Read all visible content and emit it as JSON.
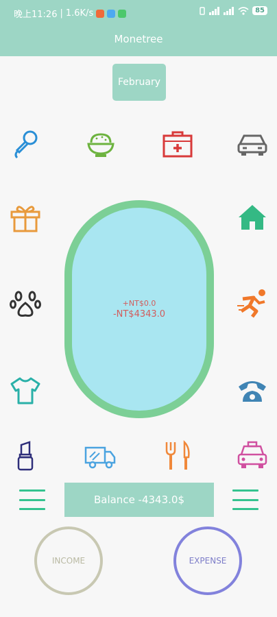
{
  "status_bar": {
    "time": "晚上11:26",
    "network_speed": "1.6K/s",
    "battery": "85",
    "colors": {
      "notif1": "#f06a3a",
      "notif2": "#4da9f1",
      "notif3": "#4cc86c"
    }
  },
  "app": {
    "title": "Monetree"
  },
  "month_selector": {
    "label": "February"
  },
  "summary": {
    "income_text": "+NT$0.0",
    "expense_text": "-NT$4343.0"
  },
  "balance": {
    "label": "Balance -4343.0$"
  },
  "actions": {
    "income_label": "INCOME",
    "expense_label": "EXPENSE"
  },
  "categories": [
    {
      "icon": "microphone-icon",
      "color": "#2a8fd6"
    },
    {
      "icon": "rice-bowl-icon",
      "color": "#6db33f"
    },
    {
      "icon": "first-aid-kit-icon",
      "color": "#d83a3a"
    },
    {
      "icon": "car-icon",
      "color": "#666666"
    },
    {
      "icon": "gift-icon",
      "color": "#e89a3c"
    },
    {
      "icon": "house-icon",
      "color": "#34b984"
    },
    {
      "icon": "paw-icon",
      "color": "#333333"
    },
    {
      "icon": "running-icon",
      "color": "#f0782a"
    },
    {
      "icon": "t-shirt-icon",
      "color": "#2ab0a8"
    },
    {
      "icon": "telephone-icon",
      "color": "#3f84b4"
    },
    {
      "icon": "lipstick-icon",
      "color": "#2e2e7a"
    },
    {
      "icon": "delivery-truck-icon",
      "color": "#4aa3e0"
    },
    {
      "icon": "fork-knife-icon",
      "color": "#f0883a"
    },
    {
      "icon": "taxi-icon",
      "color": "#d050a0"
    }
  ]
}
